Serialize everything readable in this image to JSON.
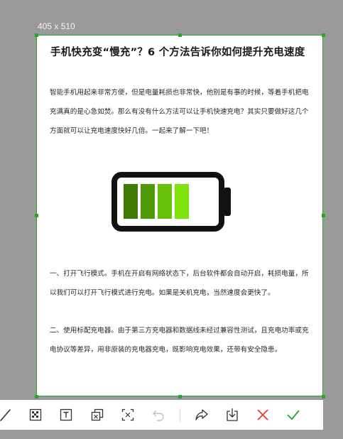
{
  "capture": {
    "size_label": "405 x 510",
    "border_color": "#2aa52a"
  },
  "article": {
    "title": "手机快充变“慢充”？6 个方法告诉你如何提升充电速度",
    "intro": "智能手机用起来非常方便，但是电量耗损也非常快，他别是有事的时候，等着手机把电充满真的是心急如焚。那么有没有什么方法可以让手机快速充电？其实只要做好这几个方面就可以让充电速度快好几倍。一起来了解一下吧！",
    "paragraph_1": "一、打开飞行模式。手机在开启有网络状态下，后台软件都会自动开启，耗损电量，所以我们可以打开飞行模式进行充电。如果是关机充电，当然速度会更快了。",
    "paragraph_2": "二、使用标配充电器。由于第三方充电器和数据线未经过兼容性测试，且充电功率或充电协议等差异，用非原装的充电器充电，既影响充电效果，还带有安全隐患。",
    "battery_image": {
      "icon": "battery-icon",
      "level": 0.75,
      "bar_colors": [
        "#3f7a05",
        "#4f9a08",
        "#67c10b",
        "#7fe30c"
      ]
    }
  },
  "toolbar": {
    "tools": [
      {
        "name": "pen-tool",
        "icon": "pen-icon"
      },
      {
        "name": "mosaic-tool",
        "icon": "mosaic-icon"
      },
      {
        "name": "text-tool",
        "icon": "text-icon"
      },
      {
        "name": "copy-tool",
        "icon": "copy-icon"
      },
      {
        "name": "recognize-tool",
        "icon": "scan-icon"
      },
      {
        "name": "undo-tool",
        "icon": "undo-icon"
      },
      {
        "name": "share-tool",
        "icon": "share-icon"
      },
      {
        "name": "save-tool",
        "icon": "download-icon"
      },
      {
        "name": "cancel-tool",
        "icon": "close-icon"
      },
      {
        "name": "confirm-tool",
        "icon": "check-icon"
      }
    ],
    "cancel_color": "#e53935",
    "confirm_color": "#2aa52a"
  }
}
